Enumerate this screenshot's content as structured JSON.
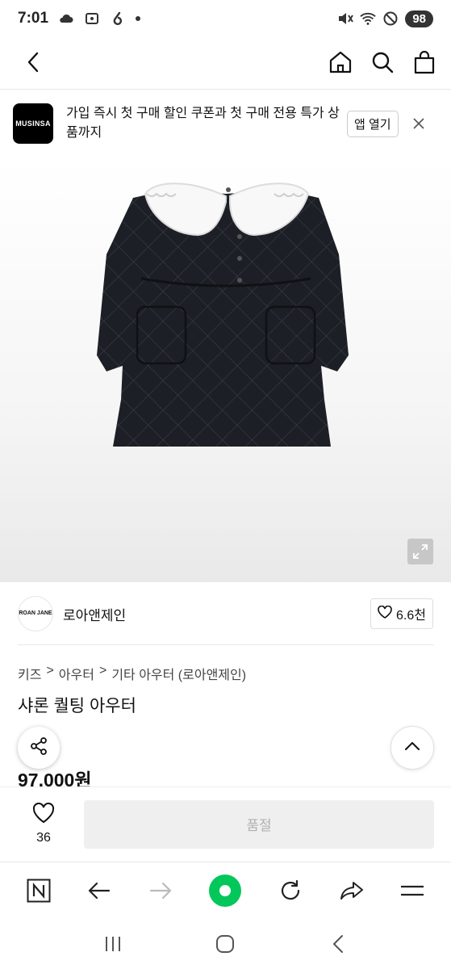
{
  "status_bar": {
    "time": "7:01",
    "battery": "98"
  },
  "banner": {
    "logo_text": "MUSINSA",
    "message": "가입 즉시 첫 구매 할인 쿠폰과 첫 구매 전용 특가 상품까지",
    "app_open_label": "앱 열기"
  },
  "brand": {
    "logo_text": "ROAN JANE",
    "name": "로아앤제인",
    "likes": "6.6천"
  },
  "product": {
    "breadcrumb": [
      "키즈",
      "아우터",
      "기타 아우터 (로아앤제인)"
    ],
    "breadcrumb_sep": ">",
    "title": "샤론 퀄팅 아우터",
    "price": "97,000원"
  },
  "buy_bar": {
    "wish_count": "36",
    "button_label": "품절"
  },
  "icons": {
    "back": "chevron-left-icon",
    "home": "home-icon",
    "search": "search-icon",
    "cart": "shopping-bag-icon",
    "share": "share-icon",
    "scroll_top": "chevron-up-icon",
    "expand": "expand-icon",
    "heart": "heart-icon"
  },
  "colors": {
    "accent_green": "#03c75a",
    "soldout_bg": "#efefef",
    "soldout_text": "#b0b0b0"
  }
}
